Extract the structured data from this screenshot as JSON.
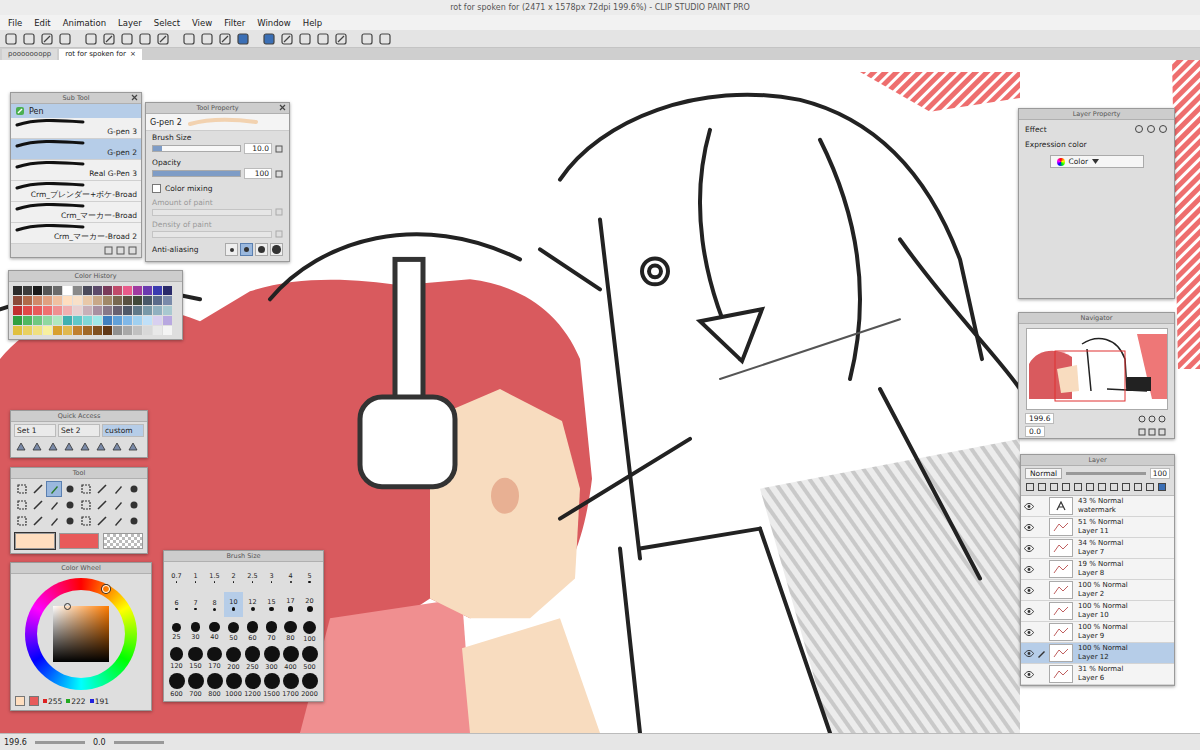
{
  "window": {
    "title": "rot for spoken for (2471 x 1578px 72dpi 199.6%) - CLIP STUDIO PAINT PRO"
  },
  "menu": [
    "File",
    "Edit",
    "Animation",
    "Layer",
    "Select",
    "View",
    "Filter",
    "Window",
    "Help"
  ],
  "documentTabs": [
    {
      "label": "pooooooopp",
      "selected": false,
      "close": ""
    },
    {
      "label": "rot for spoken for",
      "selected": true,
      "close": "×"
    }
  ],
  "subTool": {
    "title": "Sub Tool",
    "group": "Pen",
    "items": [
      {
        "label": "G-pen 3",
        "selected": false
      },
      {
        "label": "G-pen 2",
        "selected": true
      },
      {
        "label": "Real G-Pen 3",
        "selected": false
      },
      {
        "label": "Crm_ブレンダー+ボケ-Broad",
        "selected": false
      },
      {
        "label": "Crm_マーカー-Broad",
        "selected": false
      },
      {
        "label": "Crm_マーカー-Broad 2",
        "selected": false
      }
    ]
  },
  "toolProperty": {
    "title": "Tool Property",
    "brush": "G-pen 2",
    "rows": [
      {
        "kind": "slider",
        "label": "Brush Size",
        "value": "10.0",
        "level": 0.1,
        "disabled": false
      },
      {
        "kind": "slider",
        "label": "Opacity",
        "value": "100",
        "level": 1,
        "disabled": false
      },
      {
        "kind": "checkbox",
        "label": "Color mixing",
        "checked": false,
        "disabled": false
      },
      {
        "kind": "slider",
        "label": "Amount of paint",
        "value": "",
        "level": 0,
        "disabled": true
      },
      {
        "kind": "slider",
        "label": "Density of paint",
        "value": "",
        "level": 0,
        "disabled": true
      }
    ],
    "antiAliasing": {
      "label": "Anti-aliasing",
      "options": [
        {
          "selected": false
        },
        {
          "selected": true
        },
        {
          "selected": false
        },
        {
          "selected": false
        }
      ]
    }
  },
  "colorHistory": {
    "title": "Color History",
    "colors": [
      "#2b2b2b",
      "#3c3c3c",
      "#1a1a1a",
      "#555555",
      "#6b6b6b",
      "#ffffff",
      "#8a8a8a",
      "#4a4a5a",
      "#5c4a6a",
      "#7a3a5a",
      "#c04a6a",
      "#e85a8a",
      "#a03aa0",
      "#6a3ab0",
      "#3a3ab0",
      "#2a2a6a",
      "#8a4a3a",
      "#b06a4a",
      "#d08a6a",
      "#e0a080",
      "#f0c0a0",
      "#ffdebf",
      "#f8e0c8",
      "#e8c8a8",
      "#c8a888",
      "#a08868",
      "#786850",
      "#585040",
      "#404838",
      "#485868",
      "#5a6a8a",
      "#7a8aaa",
      "#c03030",
      "#e04848",
      "#e85a5a",
      "#f07070",
      "#f09090",
      "#f0b0b0",
      "#e8d0d0",
      "#c8b0b8",
      "#a890a0",
      "#887888",
      "#686070",
      "#505868",
      "#607888",
      "#7898a8",
      "#90b0c0",
      "#a8c8d0",
      "#30a040",
      "#50b860",
      "#70c880",
      "#90d8a0",
      "#b0e8c0",
      "#40b0b0",
      "#60c8c8",
      "#80d8d8",
      "#a0e8e8",
      "#4080c0",
      "#60a0d8",
      "#80b8e8",
      "#a0d0f0",
      "#c0e0f8",
      "#d8d0f0",
      "#b8a8e0",
      "#e0c040",
      "#e8d060",
      "#f0e080",
      "#f8f0a0",
      "#d8a030",
      "#e0b850",
      "#c08030",
      "#a06828",
      "#805020",
      "#603818",
      "#909090",
      "#a8a8a8",
      "#c0c0c0",
      "#d8d8d8",
      "#e8e8e8",
      "#f4f4f4"
    ]
  },
  "quickAccess": {
    "title": "Quick Access",
    "tabs": [
      {
        "label": "Set 1",
        "selected": false
      },
      {
        "label": "Set 2",
        "selected": false
      },
      {
        "label": "custom",
        "selected": true
      }
    ]
  },
  "tool": {
    "title": "Tool",
    "tools": [
      {
        "selected": false
      },
      {
        "selected": false
      },
      {
        "selected": true
      },
      {
        "selected": false
      },
      {
        "selected": false
      },
      {
        "selected": false
      },
      {
        "selected": false
      },
      {
        "selected": false
      },
      {
        "selected": false
      },
      {
        "selected": false
      },
      {
        "selected": false
      },
      {
        "selected": false
      },
      {
        "selected": false
      },
      {
        "selected": false
      },
      {
        "selected": false
      },
      {
        "selected": false
      },
      {
        "selected": false
      },
      {
        "selected": false
      },
      {
        "selected": false
      },
      {
        "selected": false
      },
      {
        "selected": false
      },
      {
        "selected": false
      },
      {
        "selected": false
      },
      {
        "selected": false
      }
    ],
    "swatches": [
      {
        "kind": "color",
        "color": "#ffdebf",
        "selected": true
      },
      {
        "kind": "color",
        "color": "#e85a5a",
        "selected": false
      },
      {
        "kind": "transparent",
        "color": "#ffffff",
        "selected": false
      }
    ]
  },
  "colorWheel": {
    "title": "Color Wheel",
    "main": "#ffdebf",
    "sub": "#e85a5a",
    "rgb": [
      "255",
      "222",
      "191"
    ]
  },
  "brushSize": {
    "title": "Brush Size",
    "sizes": [
      {
        "label": "0.7",
        "selected": false
      },
      {
        "label": "1",
        "selected": false
      },
      {
        "label": "1.5",
        "selected": false
      },
      {
        "label": "2",
        "selected": false
      },
      {
        "label": "2.5",
        "selected": false
      },
      {
        "label": "3",
        "selected": false
      },
      {
        "label": "4",
        "selected": false
      },
      {
        "label": "5",
        "selected": false
      },
      {
        "label": "6",
        "selected": false
      },
      {
        "label": "7",
        "selected": false
      },
      {
        "label": "8",
        "selected": false
      },
      {
        "label": "10",
        "selected": true
      },
      {
        "label": "12",
        "selected": false
      },
      {
        "label": "15",
        "selected": false
      },
      {
        "label": "17",
        "selected": false
      },
      {
        "label": "20",
        "selected": false
      },
      {
        "label": "25",
        "selected": false
      },
      {
        "label": "30",
        "selected": false
      },
      {
        "label": "40",
        "selected": false
      },
      {
        "label": "50",
        "selected": false
      },
      {
        "label": "60",
        "selected": false
      },
      {
        "label": "70",
        "selected": false
      },
      {
        "label": "80",
        "selected": false
      },
      {
        "label": "100",
        "selected": false
      },
      {
        "label": "120",
        "selected": false
      },
      {
        "label": "150",
        "selected": false
      },
      {
        "label": "170",
        "selected": false
      },
      {
        "label": "200",
        "selected": false
      },
      {
        "label": "250",
        "selected": false
      },
      {
        "label": "300",
        "selected": false
      },
      {
        "label": "400",
        "selected": false
      },
      {
        "label": "500",
        "selected": false
      },
      {
        "label": "600",
        "selected": false
      },
      {
        "label": "700",
        "selected": false
      },
      {
        "label": "800",
        "selected": false
      },
      {
        "label": "1000",
        "selected": false
      },
      {
        "label": "1200",
        "selected": false
      },
      {
        "label": "1500",
        "selected": false
      },
      {
        "label": "1700",
        "selected": false
      },
      {
        "label": "2000",
        "selected": false
      }
    ]
  },
  "layerProperty": {
    "title": "Layer Property",
    "effect": "Effect",
    "expressionLabel": "Expression color",
    "expressionValue": "Color"
  },
  "navigator": {
    "title": "Navigator",
    "zoom": "199.6",
    "angle": "0.0"
  },
  "layer": {
    "title": "Layer",
    "blend": "Normal",
    "opacity": "100",
    "layers": [
      {
        "opacity": "43 %",
        "mode": "Normal",
        "name": "watermark",
        "kind": "text",
        "visible": true,
        "selected": false
      },
      {
        "opacity": "51 %",
        "mode": "Normal",
        "name": "Layer 11",
        "kind": "raster",
        "visible": true,
        "selected": false
      },
      {
        "opacity": "34 %",
        "mode": "Normal",
        "name": "Layer 7",
        "kind": "raster",
        "visible": true,
        "selected": false
      },
      {
        "opacity": "19 %",
        "mode": "Normal",
        "name": "Layer 8",
        "kind": "raster",
        "visible": true,
        "selected": false
      },
      {
        "opacity": "100 %",
        "mode": "Normal",
        "name": "Layer 2",
        "kind": "raster",
        "visible": true,
        "selected": false
      },
      {
        "opacity": "100 %",
        "mode": "Normal",
        "name": "Layer 10",
        "kind": "raster",
        "visible": true,
        "selected": false
      },
      {
        "opacity": "100 %",
        "mode": "Normal",
        "name": "Layer 9",
        "kind": "raster",
        "visible": true,
        "selected": false
      },
      {
        "opacity": "100 %",
        "mode": "Normal",
        "name": "Layer 12",
        "kind": "raster",
        "visible": true,
        "selected": true
      },
      {
        "opacity": "31 %",
        "mode": "Normal",
        "name": "Layer 6",
        "kind": "raster",
        "visible": true,
        "selected": false
      }
    ]
  },
  "statusBar": {
    "zoom": "199.6",
    "angle": "0.0"
  }
}
